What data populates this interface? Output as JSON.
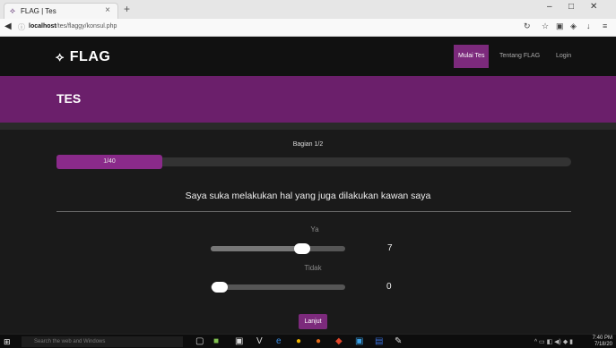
{
  "browser": {
    "tab_title": "FLAG | Tes",
    "tab_close": "×",
    "new_tab": "+",
    "url_host": "localhost",
    "url_path": "/tes/flaggy/konsul.php"
  },
  "site": {
    "logo_glyph": "⟡",
    "brand": "FLAG",
    "nav": [
      "Mulai Tes",
      "Tentang FLAG",
      "Login"
    ],
    "page_title": "TES"
  },
  "test": {
    "section": "Bagian 1/2",
    "progress_text": "1/40",
    "progress_fraction": 0.025,
    "question": "Saya suka melakukan hal yang juga dilakukan kawan saya",
    "options": [
      {
        "label": "Ya",
        "value": "7"
      },
      {
        "label": "Tidak",
        "value": "0"
      }
    ],
    "next_button": "Lanjut"
  },
  "taskbar": {
    "search_placeholder": "Search the web and Windows",
    "time": "7:40 PM",
    "date": "7/18/20"
  },
  "colors": {
    "accent": "#7c2a7c",
    "banner": "#6b1f6b"
  }
}
